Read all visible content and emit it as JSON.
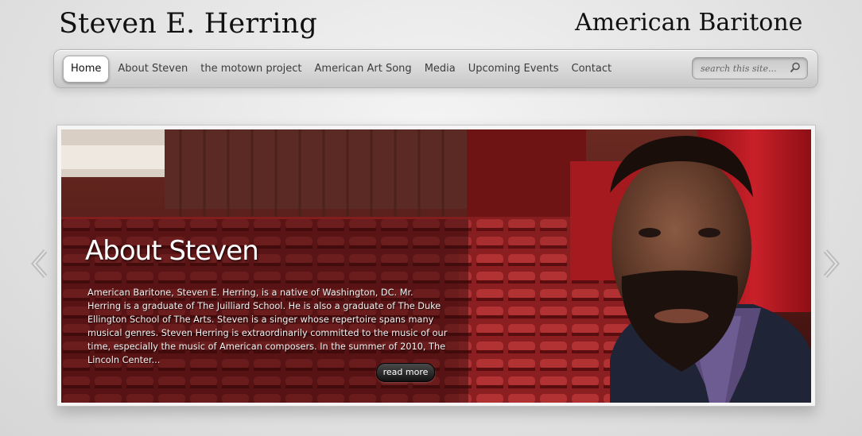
{
  "header": {
    "site_name": "Steven E. Herring",
    "tagline": "American Baritone"
  },
  "nav": {
    "items": [
      {
        "label": "Home",
        "active": true
      },
      {
        "label": "About Steven"
      },
      {
        "label": "the motown project"
      },
      {
        "label": "American Art Song"
      },
      {
        "label": "Media"
      },
      {
        "label": "Upcoming Events"
      },
      {
        "label": "Contact"
      }
    ]
  },
  "search": {
    "placeholder": "search this site..."
  },
  "slide": {
    "title": "About Steven",
    "text": "American Baritone, Steven E. Herring, is a native of Washington, DC.  Mr. Herring is a graduate of The Juilliard School.  He is also a graduate of The Duke Ellington School of The Arts.  Steven is a singer whose repertoire spans many musical genres. Steven Herring is extraordinarily committed to the music of our time, especially the music of American composers.  In the summer of 2010, The Lincoln Center...",
    "read_more": "read more"
  },
  "colors": {
    "theater_red": "#8e1a1c",
    "nav_bg": "#d4d4d4"
  },
  "icons": {
    "search": "search-icon",
    "prev": "chevron-left-icon",
    "next": "chevron-right-icon"
  }
}
